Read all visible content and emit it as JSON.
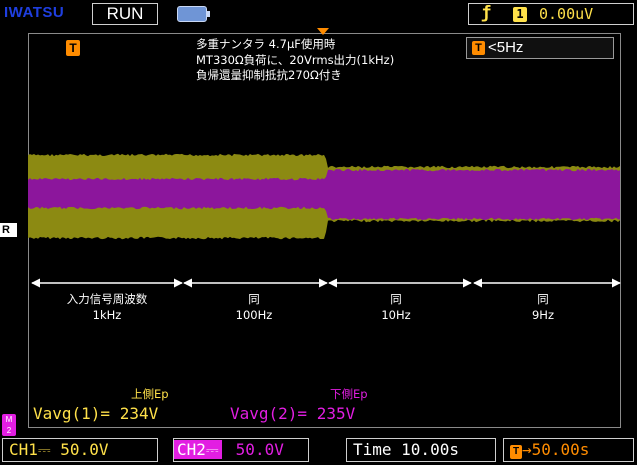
{
  "header": {
    "brand": "IWATSU",
    "run_state": "RUN",
    "trigger_source": "1",
    "trigger_level": "0.00uV"
  },
  "annotations": {
    "line1": "多重ナンタラ 4.7μF使用時",
    "line2": "MT330Ω負荷に、20Vrms出力(1kHz)",
    "line3": "負帰還量抑制抵抗270Ω付き"
  },
  "filter": {
    "label": "<5Hz"
  },
  "markers": {
    "trigger_time": "T",
    "ref": "R"
  },
  "segments": [
    {
      "line1": "入力信号周波数",
      "line2": "1kHz"
    },
    {
      "line1": "同",
      "line2": "100Hz"
    },
    {
      "line1": "同",
      "line2": "10Hz"
    },
    {
      "line1": "同",
      "line2": "9Hz"
    }
  ],
  "measurements": {
    "upper_label": "上側Ep",
    "lower_label": "下側Ep",
    "vavg1": "Vavg(1)= 234V",
    "vavg2": "Vavg(2)= 235V"
  },
  "channels": {
    "ch1": "CH1⎓  50.0V",
    "ch2_tag": "CH2⎓",
    "ch2_value": "50.0V",
    "timebase": "Time 10.00s",
    "trigger_delay": "50.00s"
  },
  "colors": {
    "ch1": "#ffe14a",
    "ch1_trace": "#8c8a12",
    "ch2": "#e21ee2",
    "ch2_trace": "#8c169c",
    "trigger": "#ff8c00",
    "brand": "#1f3fe0"
  },
  "icons": [
    "battery-icon",
    "rising-edge-icon",
    "trigger-position-marker-icon",
    "double-arrow-icon"
  ]
}
